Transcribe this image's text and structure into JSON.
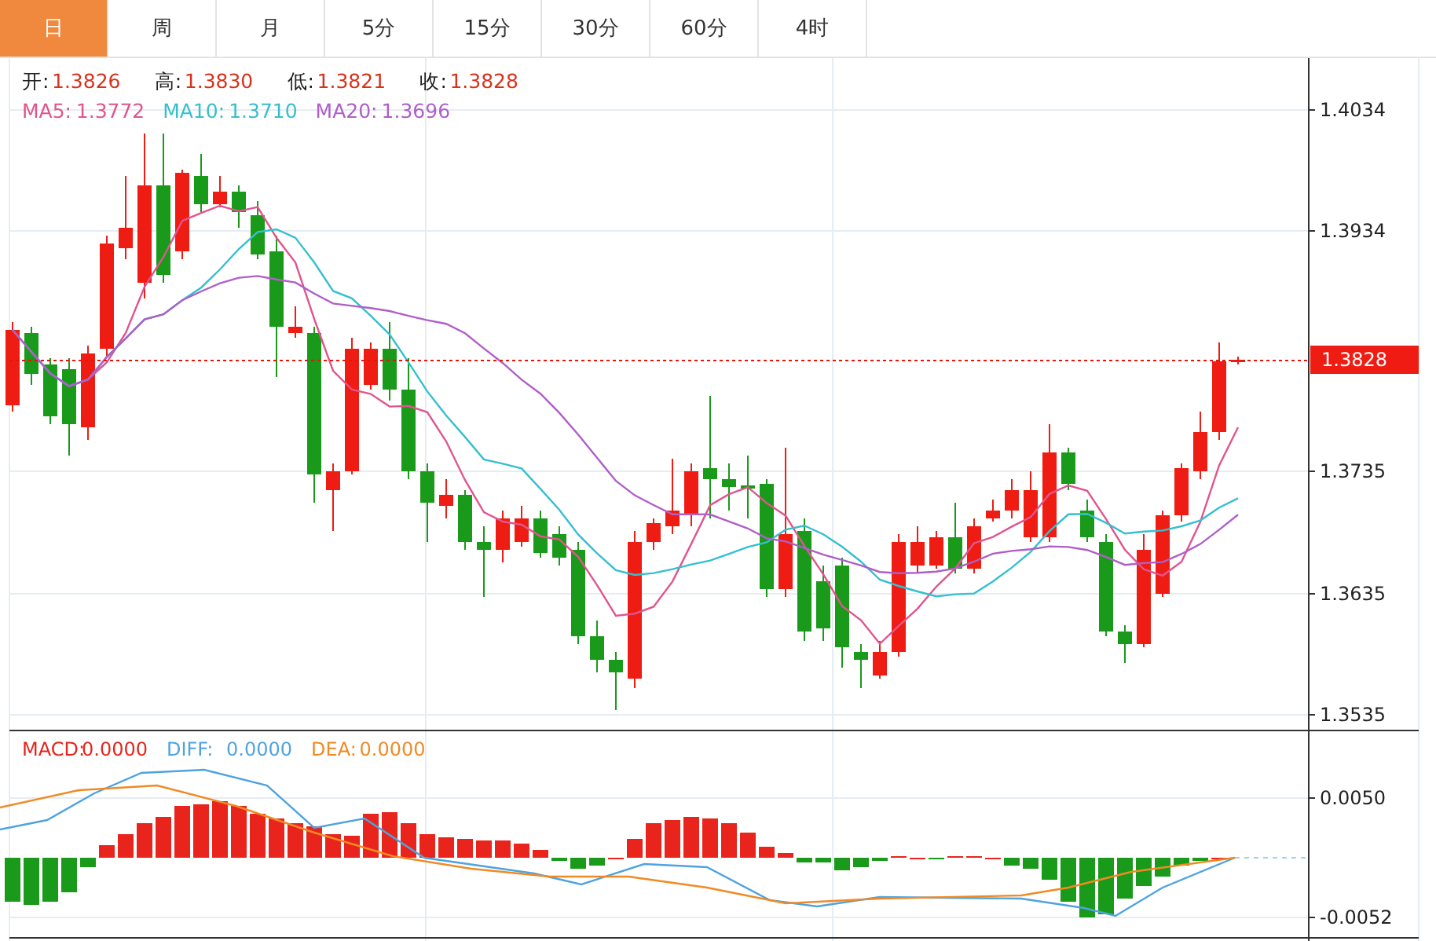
{
  "tabs": [
    {
      "label": "日",
      "selected": true
    },
    {
      "label": "周",
      "selected": false
    },
    {
      "label": "月",
      "selected": false
    },
    {
      "label": "5分",
      "selected": false
    },
    {
      "label": "15分",
      "selected": false
    },
    {
      "label": "30分",
      "selected": false
    },
    {
      "label": "60分",
      "selected": false
    },
    {
      "label": "4时",
      "selected": false
    }
  ],
  "price_chart": {
    "ohlc": [
      {
        "label": "开:",
        "value": "1.3826"
      },
      {
        "label": "高:",
        "value": "1.3830"
      },
      {
        "label": "低:",
        "value": "1.3821"
      },
      {
        "label": "收:",
        "value": "1.3828"
      }
    ],
    "moving_averages": [
      {
        "label": "MA5:",
        "value": "1.3772",
        "color": "#e0558f"
      },
      {
        "label": "MA10:",
        "value": "1.3710",
        "color": "#35bfd0"
      },
      {
        "label": "MA20:",
        "value": "1.3696",
        "color": "#b05ec8"
      }
    ],
    "y_ticks": [
      "1.4034",
      "1.3934",
      "1.3735",
      "1.3635",
      "1.3535"
    ],
    "current_price": "1.3828"
  },
  "macd_chart": {
    "legend": [
      {
        "label": "MACD:",
        "value": "0.0000",
        "color": "#e8241c"
      },
      {
        "label": "DIFF:",
        "value": "0.0000",
        "color": "#4fa3e0"
      },
      {
        "label": "DEA:",
        "value": "0.0000",
        "color": "#f08a24"
      }
    ],
    "y_ticks": [
      "0.0050",
      "-0.0052"
    ]
  }
}
